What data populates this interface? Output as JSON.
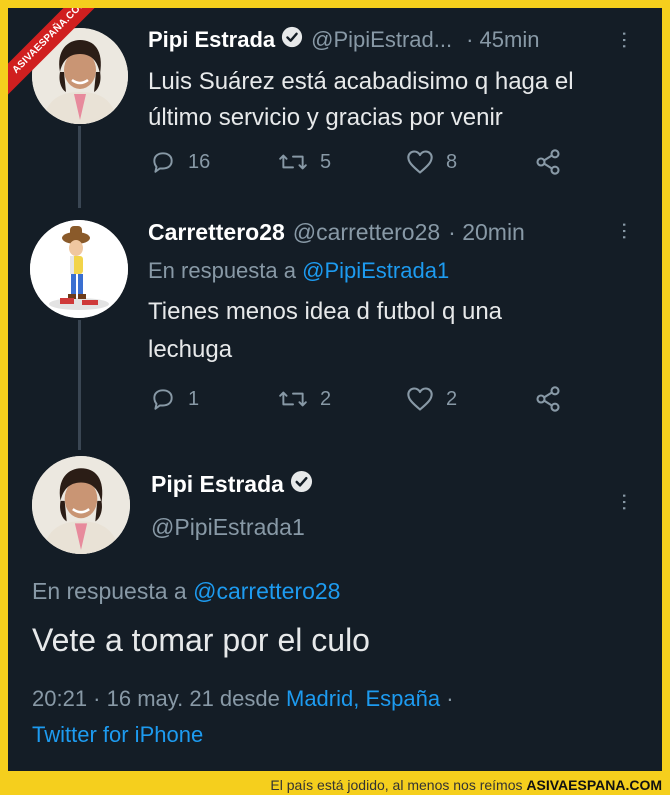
{
  "watermark": "ASIVAESPAÑA.COM",
  "tweet1": {
    "name": "Pipi Estrada",
    "handle": "@PipiEstrad...",
    "time": "· 45min",
    "text_line1": "Luis Suárez está acabadisimo q haga el",
    "text_line2": "último servicio y gracias por venir",
    "replies": "16",
    "retweets": "5",
    "likes": "8"
  },
  "tweet2": {
    "name": "Carrettero28",
    "handle": "@carrettero28",
    "time": "· 20min",
    "reply_prefix": "En respuesta a",
    "reply_handle": "@PipiEstrada1",
    "text_line1": "Tienes menos idea d futbol q una",
    "text_line2": "lechuga",
    "replies": "1",
    "retweets": "2",
    "likes": "2"
  },
  "tweet3": {
    "name": "Pipi Estrada",
    "handle": "@PipiEstrada1",
    "reply_prefix": "En respuesta a",
    "reply_handle": "@carrettero28",
    "text": "Vete a tomar por el culo",
    "datetime": "20:21 · 16 may. 21 desde",
    "location": "Madrid, España",
    "sep": "·",
    "source": "Twitter for iPhone"
  },
  "caption": {
    "text": "El país está jodido, al menos nos reímos",
    "brand": "ASIVAESPANA.COM"
  },
  "colors": {
    "background": "#141d26",
    "frame": "#f5cf1d",
    "link": "#1d9bf0",
    "muted": "#8899a6"
  }
}
